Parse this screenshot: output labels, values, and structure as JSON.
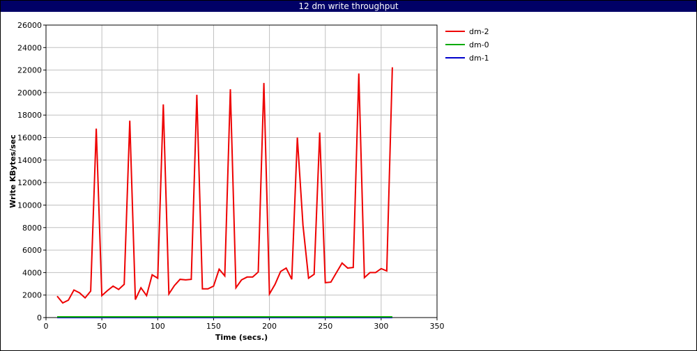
{
  "chart_data": {
    "type": "line",
    "title": "12 dm write throughput",
    "xlabel": "Time (secs.)",
    "ylabel": "Write KBytes/sec",
    "xlim": [
      0,
      350
    ],
    "ylim": [
      0,
      26000
    ],
    "xticks": [
      0,
      50,
      100,
      150,
      200,
      250,
      300,
      350
    ],
    "yticks": [
      0,
      2000,
      4000,
      6000,
      8000,
      10000,
      12000,
      14000,
      16000,
      18000,
      20000,
      22000,
      24000,
      26000
    ],
    "grid": true,
    "legend_position": "top-right",
    "series": [
      {
        "name": "dm-2",
        "color": "#ee0000",
        "points": [
          [
            10,
            1900
          ],
          [
            15,
            1300
          ],
          [
            20,
            1550
          ],
          [
            25,
            2450
          ],
          [
            30,
            2200
          ],
          [
            35,
            1750
          ],
          [
            40,
            2350
          ],
          [
            45,
            16800
          ],
          [
            50,
            1950
          ],
          [
            55,
            2400
          ],
          [
            60,
            2800
          ],
          [
            65,
            2500
          ],
          [
            70,
            2950
          ],
          [
            75,
            17500
          ],
          [
            80,
            1600
          ],
          [
            85,
            2650
          ],
          [
            90,
            1950
          ],
          [
            95,
            3800
          ],
          [
            100,
            3500
          ],
          [
            105,
            18950
          ],
          [
            110,
            2100
          ],
          [
            115,
            2850
          ],
          [
            120,
            3400
          ],
          [
            125,
            3350
          ],
          [
            130,
            3400
          ],
          [
            135,
            19800
          ],
          [
            140,
            2550
          ],
          [
            145,
            2550
          ],
          [
            150,
            2800
          ],
          [
            155,
            4300
          ],
          [
            160,
            3700
          ],
          [
            165,
            20300
          ],
          [
            170,
            2650
          ],
          [
            175,
            3350
          ],
          [
            180,
            3600
          ],
          [
            185,
            3600
          ],
          [
            190,
            4050
          ],
          [
            195,
            20850
          ],
          [
            200,
            2100
          ],
          [
            205,
            2950
          ],
          [
            210,
            4100
          ],
          [
            215,
            4400
          ],
          [
            220,
            3400
          ],
          [
            225,
            16000
          ],
          [
            230,
            8200
          ],
          [
            235,
            3500
          ],
          [
            240,
            3850
          ],
          [
            245,
            16450
          ],
          [
            250,
            3100
          ],
          [
            255,
            3150
          ],
          [
            260,
            4000
          ],
          [
            265,
            4850
          ],
          [
            270,
            4400
          ],
          [
            275,
            4450
          ],
          [
            280,
            21700
          ],
          [
            285,
            3550
          ],
          [
            290,
            4000
          ],
          [
            295,
            4000
          ],
          [
            300,
            4350
          ],
          [
            305,
            4150
          ],
          [
            310,
            22250
          ]
        ]
      },
      {
        "name": "dm-0",
        "color": "#00aa00",
        "points": [
          [
            10,
            60
          ],
          [
            50,
            60
          ],
          [
            100,
            60
          ],
          [
            150,
            60
          ],
          [
            200,
            60
          ],
          [
            250,
            60
          ],
          [
            300,
            60
          ],
          [
            310,
            60
          ]
        ]
      },
      {
        "name": "dm-1",
        "color": "#0000cc",
        "points": [
          [
            10,
            0
          ],
          [
            310,
            0
          ]
        ]
      }
    ]
  }
}
